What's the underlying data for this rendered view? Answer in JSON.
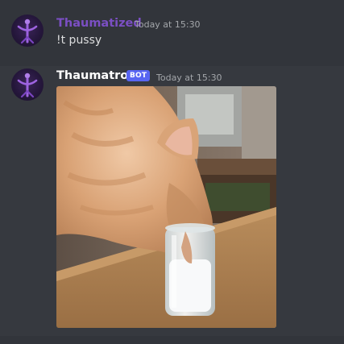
{
  "theme": {
    "background": "#36393f",
    "hover_background": "#32353b",
    "text_color": "#dcddde",
    "timestamp_color": "#a3a6aa",
    "bot_tag_color": "#5865f2"
  },
  "messages": [
    {
      "author": "Thaumatized",
      "author_color": "#7b4fc4",
      "timestamp": "Today at 15:30",
      "content": "!t pussy",
      "avatar_icon": "purple-figure-avatar"
    },
    {
      "author": "Thaumatron",
      "author_color": "#ffffff",
      "bot_tag": "BOT",
      "timestamp": "Today at 15:30",
      "avatar_icon": "purple-figure-avatar",
      "attachment": {
        "type": "image",
        "subject": "cat-drinking-from-glass"
      }
    }
  ]
}
